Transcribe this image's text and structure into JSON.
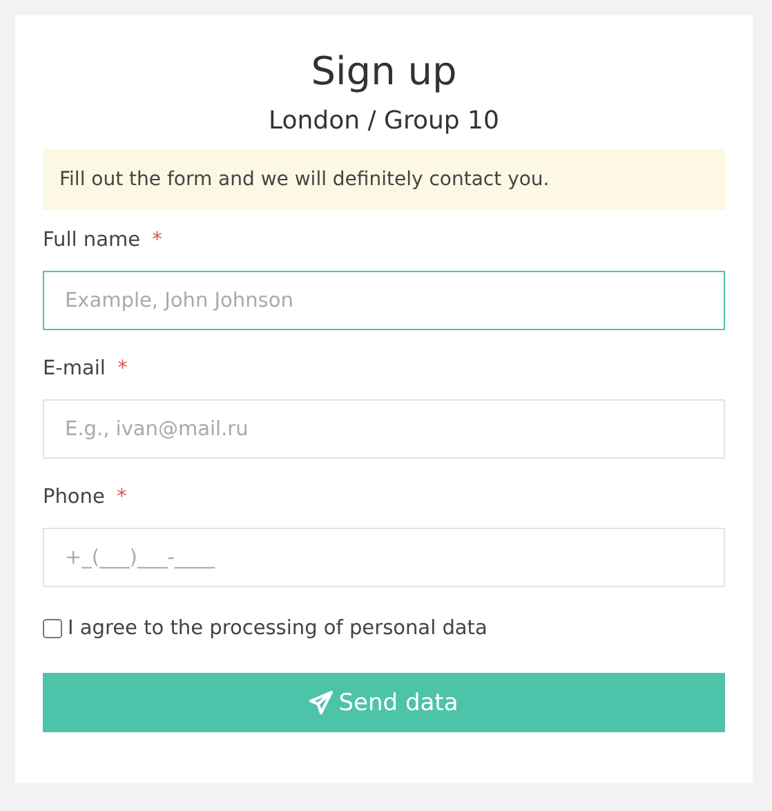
{
  "title": "Sign up",
  "subtitle": "London / Group 10",
  "notice": "Fill out the form and we will definitely contact you.",
  "fields": [
    {
      "label": "Full name",
      "required_mark": "*",
      "placeholder": "Example, John Johnson",
      "focused": true
    },
    {
      "label": "E-mail",
      "required_mark": "*",
      "placeholder": "E.g., ivan@mail.ru",
      "focused": false
    },
    {
      "label": "Phone",
      "required_mark": "*",
      "placeholder": "+_(___)___-____",
      "focused": false
    }
  ],
  "consent": {
    "label": "I agree to the processing of personal data",
    "checked": false
  },
  "submit": {
    "label": "Send data"
  }
}
